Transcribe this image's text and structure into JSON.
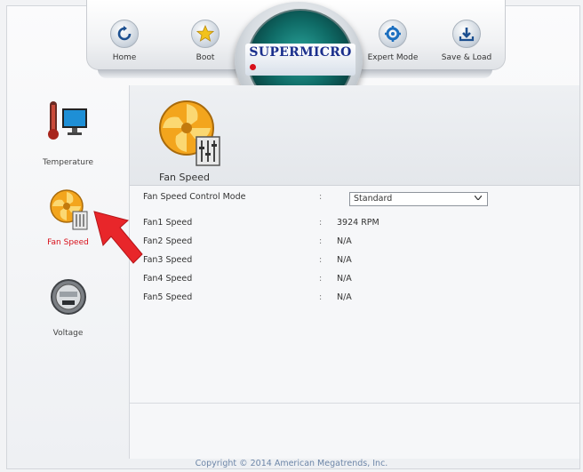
{
  "nav": {
    "items": [
      {
        "label": "Home",
        "icon": "refresh-icon"
      },
      {
        "label": "Boot",
        "icon": "star-icon"
      },
      {
        "label": "Expert Mode",
        "icon": "gear-icon"
      },
      {
        "label": "Save & Load",
        "icon": "download-icon"
      }
    ],
    "logo": "SUPERMICRO"
  },
  "sidebar": {
    "items": [
      {
        "label": "Temperature",
        "icon": "thermometer-monitor-icon",
        "active": false
      },
      {
        "label": "Fan Speed",
        "icon": "fan-icon",
        "active": true
      },
      {
        "label": "Voltage",
        "icon": "voltage-meter-icon",
        "active": false
      }
    ]
  },
  "main": {
    "title": "Fan Speed",
    "control_mode": {
      "label": "Fan Speed Control Mode",
      "colon": ":",
      "value": "Standard"
    },
    "fans": [
      {
        "label": "Fan1 Speed",
        "colon": ":",
        "value": "3924 RPM"
      },
      {
        "label": "Fan2 Speed",
        "colon": ":",
        "value": "N/A"
      },
      {
        "label": "Fan3 Speed",
        "colon": ":",
        "value": "N/A"
      },
      {
        "label": "Fan4 Speed",
        "colon": ":",
        "value": "N/A"
      },
      {
        "label": "Fan5 Speed",
        "colon": ":",
        "value": "N/A"
      }
    ]
  },
  "footer": {
    "copyright": "Copyright © 2014 American Megatrends, Inc."
  },
  "colors": {
    "accent_red": "#d8101a",
    "text": "#333333",
    "copyright": "#6d86a8",
    "logo_teal": "#0f6b66"
  }
}
